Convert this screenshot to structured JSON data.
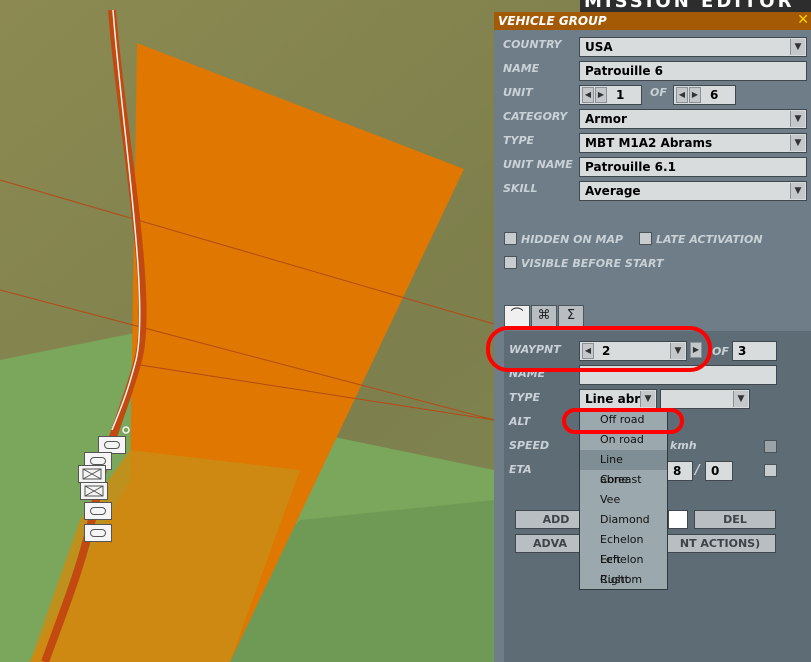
{
  "window": {
    "title": "VEHICLE GROUP",
    "close_glyph": "✕",
    "top_strip_text": "MISSION EDITOR"
  },
  "fields": {
    "country": {
      "label": "COUNTRY",
      "value": "USA"
    },
    "name": {
      "label": "NAME",
      "value": "Patrouille 6"
    },
    "unit": {
      "label": "UNIT",
      "value": "1",
      "of_label": "OF",
      "total": "6"
    },
    "category": {
      "label": "CATEGORY",
      "value": "Armor"
    },
    "type": {
      "label": "TYPE",
      "value": "MBT M1A2 Abrams"
    },
    "unit_name": {
      "label": "UNIT NAME",
      "value": "Patrouille 6.1"
    },
    "skill": {
      "label": "SKILL",
      "value": "Average"
    }
  },
  "checks": {
    "hidden_on_map": "HIDDEN ON MAP",
    "late_activation": "LATE ACTIVATION",
    "visible_before_start": "VISIBLE BEFORE START"
  },
  "tabs": [
    "route-icon",
    "targets-icon",
    "sigma-icon"
  ],
  "tab_glyphs": [
    "⌒",
    "⌘",
    "Σ"
  ],
  "waypoint": {
    "label": "WAYPNT",
    "value": "2",
    "of_label": "OF",
    "total": "3",
    "name_label": "NAME",
    "type_label": "TYPE",
    "type_value": "Line abre",
    "alt_label": "ALT",
    "speed_label": "SPEED",
    "speed_unit": "kmh",
    "eta_label": "ETA",
    "eta_h": "8",
    "eta_sep": "/",
    "eta_m": "0"
  },
  "buttons": {
    "add": "ADD",
    "del": "DEL",
    "advanced": "ADVA",
    "advanced_tail": "NT ACTIONS)"
  },
  "dropdown": {
    "options": [
      "Off road",
      "On road",
      "Line abreast",
      "Cone",
      "Vee",
      "Diamond",
      "Echelon Left",
      "Echelon Right",
      "Custom"
    ],
    "highlighted": "Line abreast"
  },
  "colors": {
    "annotation": "#ff0000",
    "title_bar": "#a45a05",
    "zone": "#e07800",
    "road": "#c24a10"
  }
}
